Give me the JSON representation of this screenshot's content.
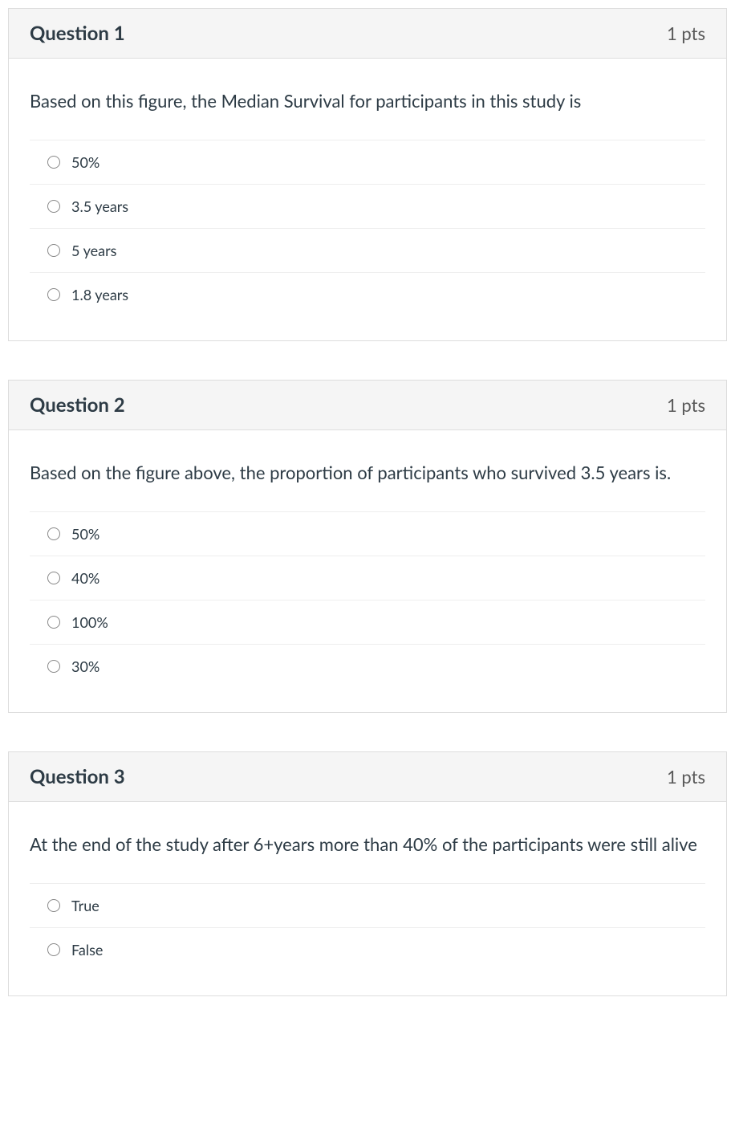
{
  "questions": [
    {
      "title": "Question 1",
      "pts": "1 pts",
      "prompt": "Based on this figure, the Median Survival for participants in this study is",
      "opt1": "50%",
      "opt2": "3.5 years",
      "opt3": "5 years",
      "opt4": "1.8 years"
    },
    {
      "title": "Question 2",
      "pts": "1 pts",
      "prompt": "Based on the figure above, the proportion of participants who survived 3.5 years is.",
      "opt1": "50%",
      "opt2": "40%",
      "opt3": "100%",
      "opt4": "30%"
    },
    {
      "title": "Question 3",
      "pts": "1 pts",
      "prompt": "At the end of the study after 6+years more than 40% of the participants were still alive",
      "opt1": "True",
      "opt2": "False"
    }
  ]
}
